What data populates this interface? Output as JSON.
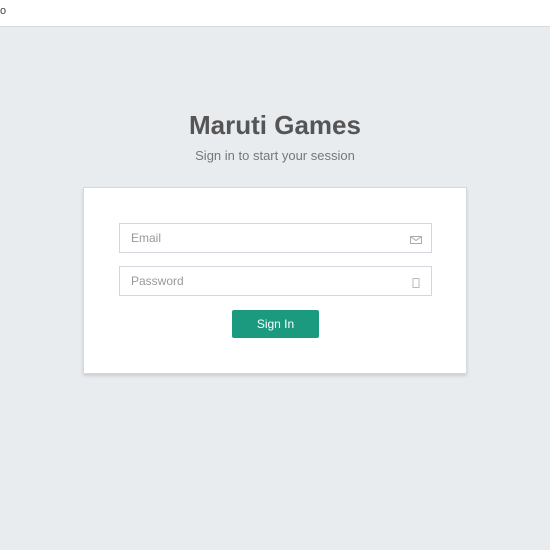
{
  "topbar": {
    "text": "o"
  },
  "login": {
    "brand": "Maruti Games",
    "subtitle": "Sign in to start your session",
    "email_placeholder": "Email",
    "email_icon": "envelope-icon",
    "password_placeholder": "Password",
    "password_icon": "lock-icon",
    "signin_label": "Sign In"
  },
  "colors": {
    "background": "#e8ecef",
    "button": "#1c9a80",
    "brand_text": "#555555"
  }
}
